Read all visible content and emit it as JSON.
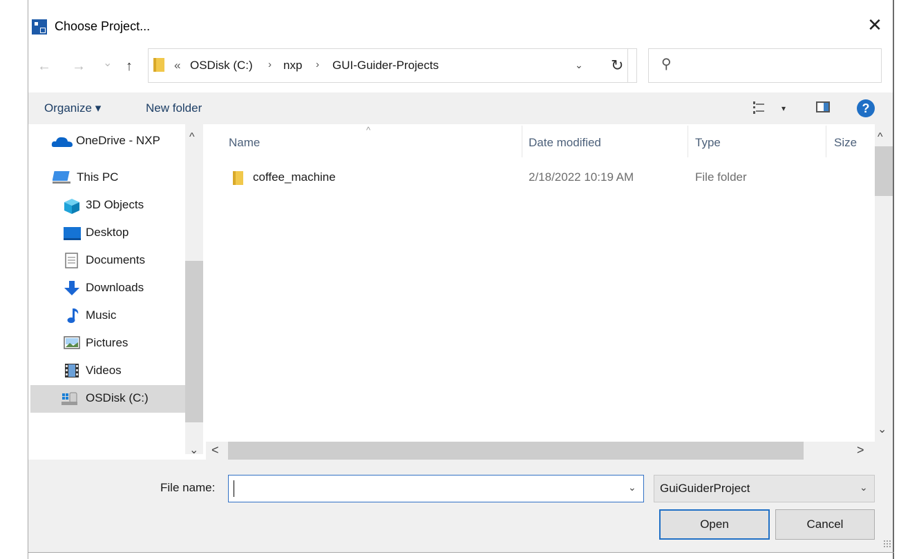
{
  "window": {
    "title": "Choose Project...",
    "close_glyph": "✕"
  },
  "nav": {
    "back_glyph": "←",
    "forward_glyph": "→",
    "recent_glyph": "⌄",
    "up_glyph": "↑",
    "breadcrumb_prefix": "«",
    "breadcrumbs": [
      "OSDisk (C:)",
      "nxp",
      "GUI-Guider-Projects"
    ],
    "separator": "›",
    "dropdown_glyph": "⌄",
    "refresh_glyph": "↻",
    "search_glyph": "⚲",
    "search_placeholder": ""
  },
  "toolbar": {
    "organize_label": "Organize ▾",
    "new_folder_label": "New folder",
    "view_caret": "▾",
    "help_glyph": "?"
  },
  "sidebar": {
    "items": [
      {
        "label": "OneDrive - NXP",
        "icon": "cloud-icon"
      },
      {
        "label": "This PC",
        "icon": "computer-icon"
      },
      {
        "label": "3D Objects",
        "icon": "cube-icon"
      },
      {
        "label": "Desktop",
        "icon": "desktop-icon"
      },
      {
        "label": "Documents",
        "icon": "document-icon"
      },
      {
        "label": "Downloads",
        "icon": "download-icon"
      },
      {
        "label": "Music",
        "icon": "music-icon"
      },
      {
        "label": "Pictures",
        "icon": "picture-icon"
      },
      {
        "label": "Videos",
        "icon": "film-icon"
      },
      {
        "label": "OSDisk (C:)",
        "icon": "drive-icon"
      }
    ],
    "up_arrow": "^",
    "down_arrow": "⌄"
  },
  "file_list": {
    "columns": [
      "Name",
      "Date modified",
      "Type",
      "Size"
    ],
    "sort_glyph": "^",
    "rows": [
      {
        "name": "coffee_machine",
        "date": "2/18/2022 10:19 AM",
        "type": "File folder",
        "size": ""
      }
    ],
    "scroll_up": "^",
    "scroll_down": "⌄",
    "scroll_left": "<",
    "scroll_right": ">"
  },
  "footer": {
    "file_name_label": "File name:",
    "file_name_value": "",
    "file_name_dropdown": "⌄",
    "file_type_value": "GuiGuiderProject",
    "file_type_dropdown": "⌄",
    "open_label": "Open",
    "cancel_label": "Cancel"
  },
  "colors": {
    "accent": "#1f6fc5",
    "folder": "#f1c84b",
    "toolbar_bg": "#f0f0f0"
  }
}
